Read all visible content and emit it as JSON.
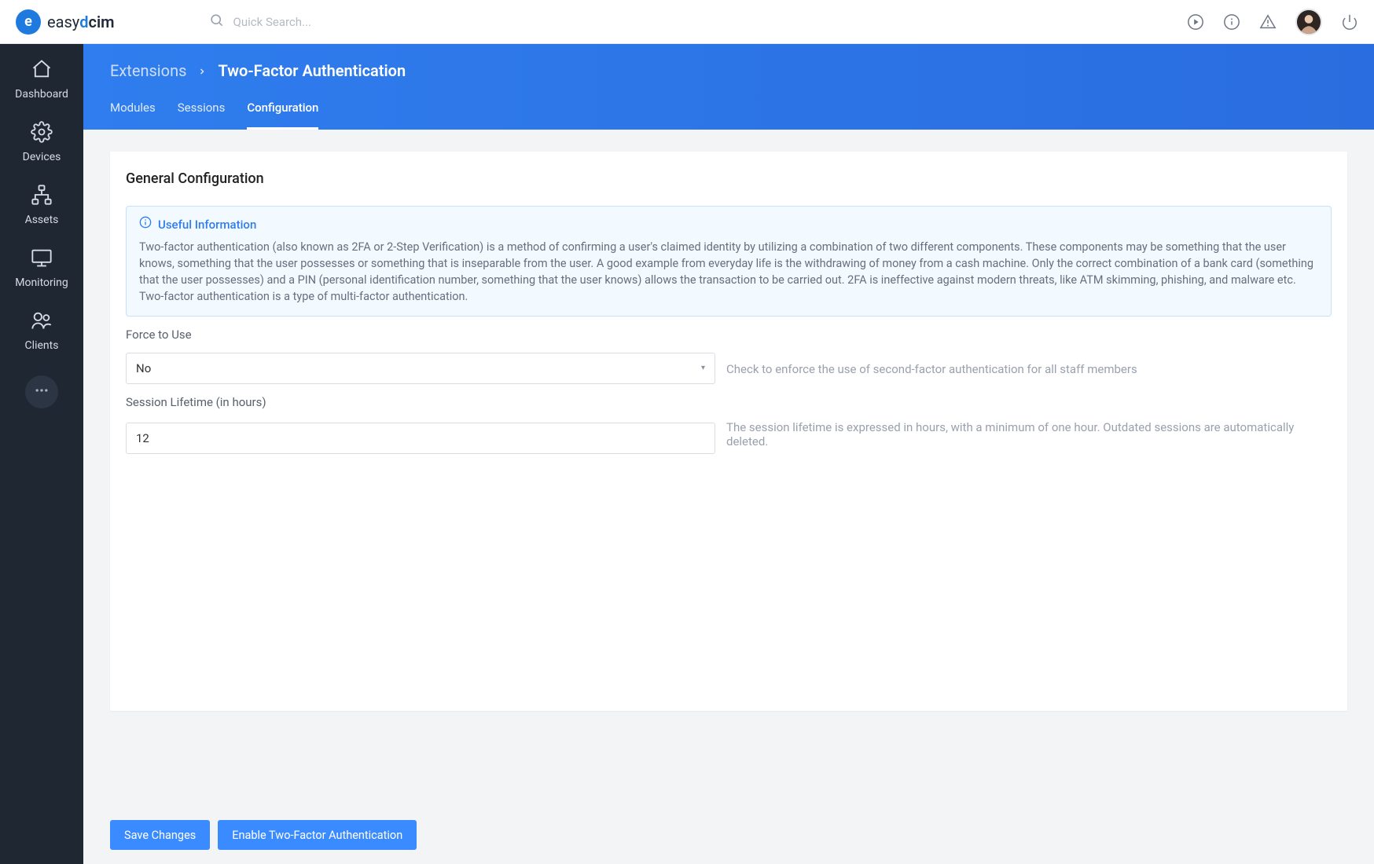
{
  "brand": {
    "easy": "easy",
    "d": "d",
    "cim": "cim",
    "mark": "e"
  },
  "search": {
    "placeholder": "Quick Search..."
  },
  "sidebar": {
    "items": [
      {
        "label": "Dashboard"
      },
      {
        "label": "Devices"
      },
      {
        "label": "Assets"
      },
      {
        "label": "Monitoring"
      },
      {
        "label": "Clients"
      }
    ]
  },
  "breadcrumb": {
    "root": "Extensions",
    "current": "Two-Factor Authentication"
  },
  "tabs": [
    {
      "label": "Modules",
      "active": false
    },
    {
      "label": "Sessions",
      "active": false
    },
    {
      "label": "Configuration",
      "active": true
    }
  ],
  "panel": {
    "title": "General Configuration",
    "alert_title": "Useful Information",
    "alert_body": "Two-factor authentication (also known as 2FA or 2-Step Verification) is a method of confirming a user's claimed identity by utilizing a combination of two different components. These components may be something that the user knows, something that the user possesses or something that is inseparable from the user. A good example from everyday life is the withdrawing of money from a cash machine. Only the correct combination of a bank card (something that the user possesses) and a PIN (personal identification number, something that the user knows) allows the transaction to be carried out. 2FA is ineffective against modern threats, like ATM skimming, phishing, and malware etc. Two-factor authentication is a type of multi-factor authentication.",
    "fields": {
      "force_label": "Force to Use",
      "force_value": "No",
      "force_help": "Check to enforce the use of second-factor authentication for all staff members",
      "lifetime_label": "Session Lifetime (in hours)",
      "lifetime_value": "12",
      "lifetime_help": "The session lifetime is expressed in hours, with a minimum of one hour. Outdated sessions are automatically deleted."
    }
  },
  "actions": {
    "save": "Save Changes",
    "enable": "Enable Two-Factor Authentication"
  }
}
